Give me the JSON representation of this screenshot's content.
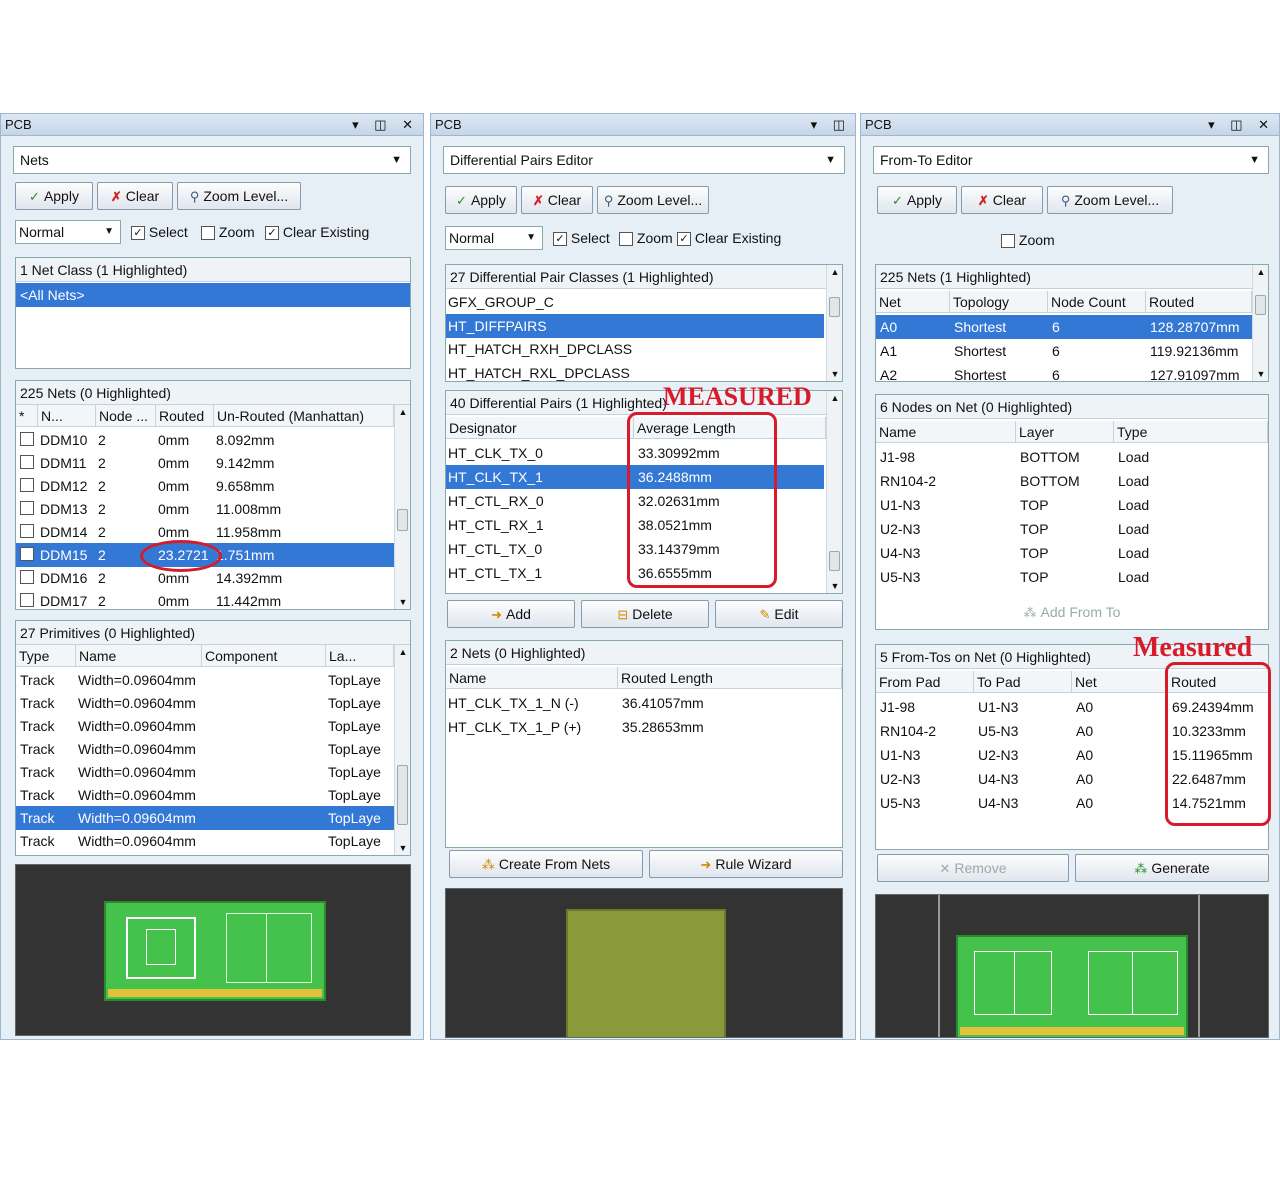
{
  "panel1": {
    "title": "PCB",
    "title_icons": "▾ ◫ ✕",
    "mode": "Nets",
    "apply": "Apply",
    "clear": "Clear",
    "zoom_level": "Zoom Level...",
    "mask_mode": "Normal",
    "select": "Select",
    "zoom": "Zoom",
    "clear_existing": "Clear Existing",
    "classes_header": "1 Net Class (1 Highlighted)",
    "class_selected": "<All Nets>",
    "nets_header": "225 Nets (0 Highlighted)",
    "nets_cols": [
      "*",
      "N...",
      "Node ...",
      "Routed",
      "Un-Routed (Manhattan)"
    ],
    "nets_rows": [
      {
        "name": "DDM10",
        "nodes": "2",
        "routed": "0mm",
        "unrouted": "8.092mm"
      },
      {
        "name": "DDM11",
        "nodes": "2",
        "routed": "0mm",
        "unrouted": "9.142mm"
      },
      {
        "name": "DDM12",
        "nodes": "2",
        "routed": "0mm",
        "unrouted": "9.658mm"
      },
      {
        "name": "DDM13",
        "nodes": "2",
        "routed": "0mm",
        "unrouted": "11.008mm"
      },
      {
        "name": "DDM14",
        "nodes": "2",
        "routed": "0mm",
        "unrouted": "11.958mm"
      },
      {
        "name": "DDM15",
        "nodes": "2",
        "routed": "23.2721",
        "unrouted": "1.751mm"
      },
      {
        "name": "DDM16",
        "nodes": "2",
        "routed": "0mm",
        "unrouted": "14.392mm"
      },
      {
        "name": "DDM17",
        "nodes": "2",
        "routed": "0mm",
        "unrouted": "11.442mm"
      }
    ],
    "prims_header": "27 Primitives (0 Highlighted)",
    "prims_cols": [
      "Type",
      "Name",
      "Component",
      "La..."
    ],
    "prims_rows": [
      {
        "type": "Track",
        "name": "Width=0.09604mm",
        "comp": "",
        "layer": "TopLaye"
      },
      {
        "type": "Track",
        "name": "Width=0.09604mm",
        "comp": "",
        "layer": "TopLaye"
      },
      {
        "type": "Track",
        "name": "Width=0.09604mm",
        "comp": "",
        "layer": "TopLaye"
      },
      {
        "type": "Track",
        "name": "Width=0.09604mm",
        "comp": "",
        "layer": "TopLaye"
      },
      {
        "type": "Track",
        "name": "Width=0.09604mm",
        "comp": "",
        "layer": "TopLaye"
      },
      {
        "type": "Track",
        "name": "Width=0.09604mm",
        "comp": "",
        "layer": "TopLaye"
      },
      {
        "type": "Track",
        "name": "Width=0.09604mm",
        "comp": "",
        "layer": "TopLaye"
      },
      {
        "type": "Track",
        "name": "Width=0.09604mm",
        "comp": "",
        "layer": "TopLaye"
      }
    ]
  },
  "panel2": {
    "title": "PCB",
    "title_icons": "▾ ◫",
    "mode": "Differential Pairs Editor",
    "apply": "Apply",
    "clear": "Clear",
    "zoom_level": "Zoom Level...",
    "mask_mode": "Normal",
    "select": "Select",
    "zoom": "Zoom",
    "clear_existing": "Clear Existing",
    "classes_header": "27 Differential Pair Classes (1 Highlighted)",
    "classes": [
      "GFX_GROUP_C",
      "HT_DIFFPAIRS",
      "HT_HATCH_RXH_DPCLASS",
      "HT_HATCH_RXL_DPCLASS"
    ],
    "measured_label": "MEASURED",
    "pairs_header": "40 Differential Pairs (1 Highlighted)",
    "pairs_cols": [
      "Designator",
      "Average Length"
    ],
    "pairs_rows": [
      {
        "name": "HT_CLK_TX_0",
        "len": "33.30992mm"
      },
      {
        "name": "HT_CLK_TX_1",
        "len": "36.2488mm"
      },
      {
        "name": "HT_CTL_RX_0",
        "len": "32.02631mm"
      },
      {
        "name": "HT_CTL_RX_1",
        "len": "38.0521mm"
      },
      {
        "name": "HT_CTL_TX_0",
        "len": "33.14379mm"
      },
      {
        "name": "HT_CTL_TX_1",
        "len": "36.6555mm"
      }
    ],
    "add": "Add",
    "delete": "Delete",
    "edit": "Edit",
    "nets_header": "2 Nets (0 Highlighted)",
    "nets_cols": [
      "Name",
      "Routed Length"
    ],
    "nets_rows": [
      {
        "name": "HT_CLK_TX_1_N (-)",
        "len": "36.41057mm"
      },
      {
        "name": "HT_CLK_TX_1_P (+)",
        "len": "35.28653mm"
      }
    ],
    "create_from_nets": "Create From Nets",
    "rule_wizard": "Rule Wizard"
  },
  "panel3": {
    "title": "PCB",
    "title_icons": "▾ ◫ ✕",
    "mode": "From-To Editor",
    "apply": "Apply",
    "clear": "Clear",
    "zoom_level": "Zoom Level...",
    "zoom": "Zoom",
    "nets_header": "225 Nets (1 Highlighted)",
    "nets_cols": [
      "Net",
      "Topology",
      "Node Count",
      "Routed"
    ],
    "nets_rows": [
      {
        "net": "A0",
        "topo": "Shortest",
        "nodes": "6",
        "routed": "128.28707mm"
      },
      {
        "net": "A1",
        "topo": "Shortest",
        "nodes": "6",
        "routed": "119.92136mm"
      },
      {
        "net": "A2",
        "topo": "Shortest",
        "nodes": "6",
        "routed": "127.91097mm"
      }
    ],
    "nodes_header": "6 Nodes on Net (0 Highlighted)",
    "nodes_cols": [
      "Name",
      "Layer",
      "Type"
    ],
    "nodes_rows": [
      {
        "name": "J1-98",
        "layer": "BOTTOM",
        "type": "Load"
      },
      {
        "name": "RN104-2",
        "layer": "BOTTOM",
        "type": "Load"
      },
      {
        "name": "U1-N3",
        "layer": "TOP",
        "type": "Load"
      },
      {
        "name": "U2-N3",
        "layer": "TOP",
        "type": "Load"
      },
      {
        "name": "U4-N3",
        "layer": "TOP",
        "type": "Load"
      },
      {
        "name": "U5-N3",
        "layer": "TOP",
        "type": "Load"
      }
    ],
    "add_from_to": "Add From To",
    "measured_label": "Measured",
    "fromtos_header": "5 From-Tos on Net (0 Highlighted)",
    "fromtos_cols": [
      "From Pad",
      "To Pad",
      "Net",
      "Routed"
    ],
    "fromtos_rows": [
      {
        "from": "J1-98",
        "to": "U1-N3",
        "net": "A0",
        "routed": "69.24394mm"
      },
      {
        "from": "RN104-2",
        "to": "U5-N3",
        "net": "A0",
        "routed": "10.3233mm"
      },
      {
        "from": "U1-N3",
        "to": "U2-N3",
        "net": "A0",
        "routed": "15.11965mm"
      },
      {
        "from": "U2-N3",
        "to": "U4-N3",
        "net": "A0",
        "routed": "22.6487mm"
      },
      {
        "from": "U5-N3",
        "to": "U4-N3",
        "net": "A0",
        "routed": "14.7521mm"
      }
    ],
    "remove": "Remove",
    "generate": "Generate"
  },
  "colors": {
    "selection": "#3478d6",
    "annotation_red": "#d61c2a",
    "board_green": "#44c24c",
    "panel_bg": "#e6eef6"
  }
}
